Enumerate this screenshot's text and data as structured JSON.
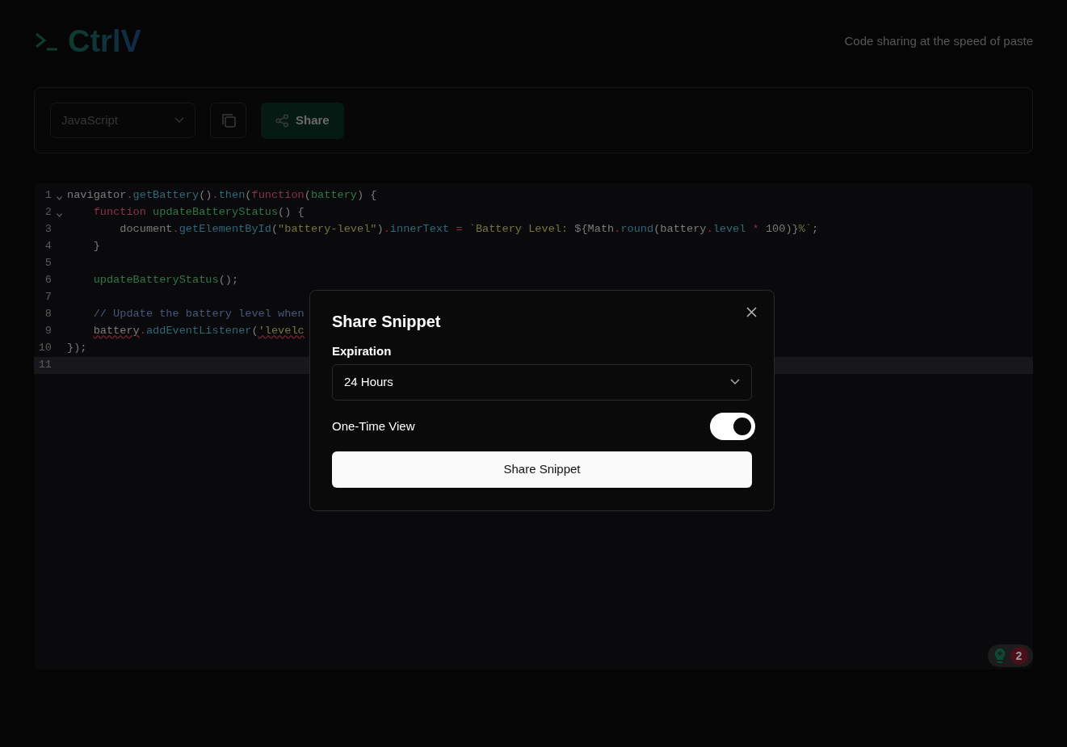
{
  "header": {
    "logo": "CtrlV",
    "tagline": "Code sharing at the speed of paste"
  },
  "toolbar": {
    "language": "JavaScript",
    "share_button": "Share"
  },
  "editor": {
    "lines": [
      {
        "number": "1",
        "foldable": true,
        "active": false,
        "tokens": [
          {
            "text": "navigator",
            "kind": "plain"
          },
          {
            "text": ".",
            "kind": "op"
          },
          {
            "text": "getBattery",
            "kind": "method"
          },
          {
            "text": "()",
            "kind": "plain"
          },
          {
            "text": ".",
            "kind": "op"
          },
          {
            "text": "then",
            "kind": "method"
          },
          {
            "text": "(",
            "kind": "plain"
          },
          {
            "text": "function",
            "kind": "keyword"
          },
          {
            "text": "(",
            "kind": "plain"
          },
          {
            "text": "battery",
            "kind": "name"
          },
          {
            "text": ") {",
            "kind": "plain"
          }
        ]
      },
      {
        "number": "2",
        "foldable": true,
        "active": false,
        "tokens": [
          {
            "text": "    function",
            "kind": "keyword"
          },
          {
            "text": " updateBatteryStatus",
            "kind": "name"
          },
          {
            "text": "() {",
            "kind": "plain"
          }
        ]
      },
      {
        "number": "3",
        "foldable": false,
        "active": false,
        "tokens": [
          {
            "text": "        document",
            "kind": "plain"
          },
          {
            "text": ".",
            "kind": "op"
          },
          {
            "text": "getElementById",
            "kind": "method"
          },
          {
            "text": "(",
            "kind": "plain"
          },
          {
            "text": "\"battery-level\"",
            "kind": "string"
          },
          {
            "text": ")",
            "kind": "plain"
          },
          {
            "text": ".",
            "kind": "op"
          },
          {
            "text": "innerText",
            "kind": "method"
          },
          {
            "text": " = ",
            "kind": "op"
          },
          {
            "text": "`Battery Level: ",
            "kind": "string"
          },
          {
            "text": "${Math",
            "kind": "plain"
          },
          {
            "text": ".",
            "kind": "op"
          },
          {
            "text": "round",
            "kind": "method"
          },
          {
            "text": "(battery",
            "kind": "plain"
          },
          {
            "text": ".",
            "kind": "op"
          },
          {
            "text": "level",
            "kind": "method"
          },
          {
            "text": " * ",
            "kind": "op"
          },
          {
            "text": "100)}",
            "kind": "plain"
          },
          {
            "text": "%`",
            "kind": "string"
          },
          {
            "text": ";",
            "kind": "plain"
          }
        ]
      },
      {
        "number": "4",
        "foldable": false,
        "active": false,
        "tokens": [
          {
            "text": "    }",
            "kind": "plain"
          }
        ]
      },
      {
        "number": "5",
        "foldable": false,
        "active": false
      },
      {
        "number": "6",
        "foldable": false,
        "active": false,
        "tokens": [
          {
            "text": "    updateBatteryStatus",
            "kind": "name"
          },
          {
            "text": "();",
            "kind": "plain"
          }
        ]
      },
      {
        "number": "7",
        "foldable": false,
        "active": false
      },
      {
        "number": "8",
        "foldable": false,
        "active": false,
        "tokens": [
          {
            "text": "    // Update the battery level when",
            "kind": "comment"
          }
        ]
      },
      {
        "number": "9",
        "foldable": false,
        "active": false,
        "tokens": [
          {
            "text": "    battery",
            "kind": "error"
          },
          {
            "text": ".",
            "kind": "op"
          },
          {
            "text": "addEventListener",
            "kind": "method"
          },
          {
            "text": "(",
            "kind": "plain"
          },
          {
            "text": "'levelc",
            "kind": "stringerror"
          }
        ]
      },
      {
        "number": "10",
        "foldable": false,
        "active": false,
        "tokens": [
          {
            "text": "});",
            "kind": "plain"
          }
        ]
      },
      {
        "number": "11",
        "foldable": false,
        "active": true
      }
    ]
  },
  "badge": {
    "count": "2"
  },
  "dialog": {
    "title": "Share Snippet",
    "expiration_label": "Expiration",
    "expiration_value": "24 Hours",
    "one_time_label": "One-Time View",
    "one_time_on": true,
    "submit": "Share Snippet"
  }
}
